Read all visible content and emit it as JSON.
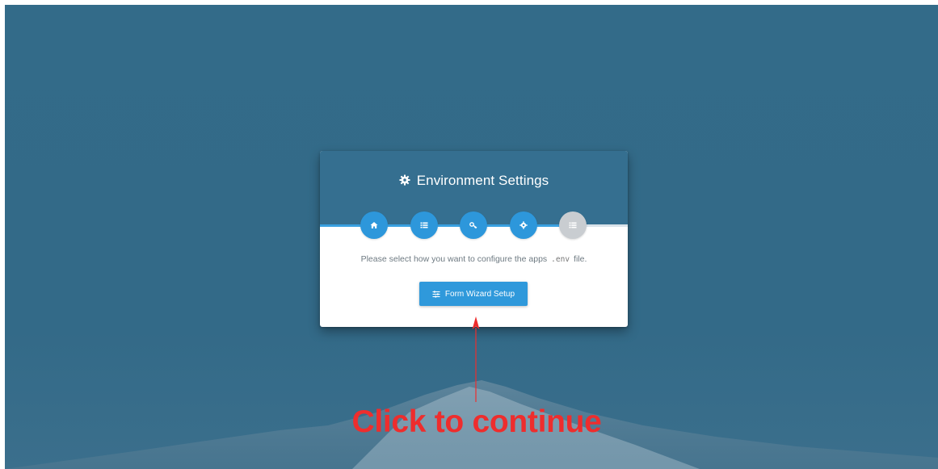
{
  "dialog": {
    "title": "Environment Settings",
    "title_icon": "gear-icon",
    "progress_percent": 80,
    "steps": [
      {
        "icon": "home-icon",
        "state": "active"
      },
      {
        "icon": "list-icon",
        "state": "active"
      },
      {
        "icon": "key-icon",
        "state": "active"
      },
      {
        "icon": "gear-icon",
        "state": "active"
      },
      {
        "icon": "list-icon",
        "state": "disabled"
      }
    ],
    "instruction_prefix": "Please select how you want to configure the apps",
    "instruction_code": ".env",
    "instruction_suffix": "file.",
    "button_label": "Form Wizard Setup",
    "button_icon": "sliders-icon"
  },
  "annotation": {
    "text": "Click to continue",
    "color": "#ee2d2d"
  },
  "colors": {
    "background": "#336b89",
    "header": "#356f90",
    "accent": "#2f99db",
    "disabled": "#c9cdd1"
  }
}
